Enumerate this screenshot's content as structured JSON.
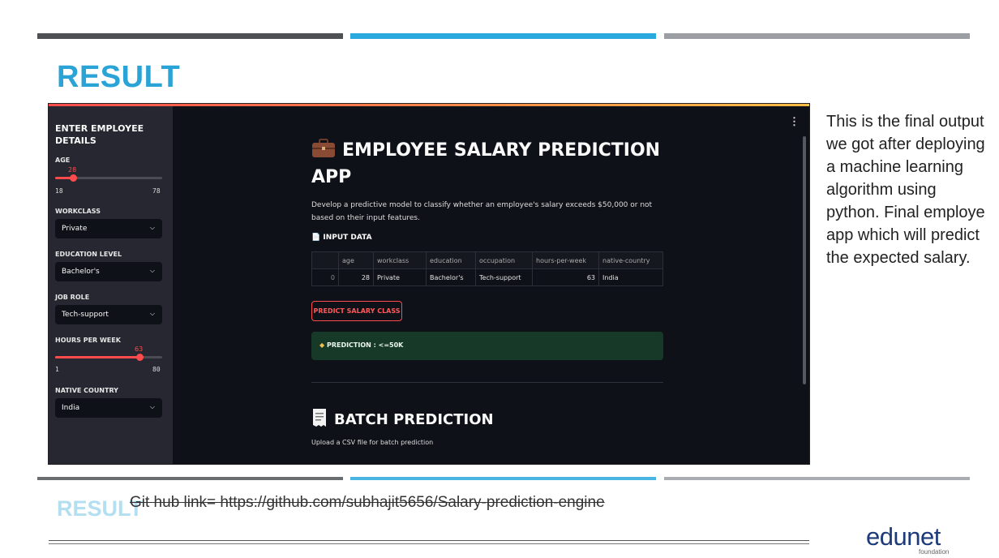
{
  "slide": {
    "title": "RESULT",
    "accent_colors": {
      "bar_dark": "#4d5153",
      "bar_blue": "#29a9de",
      "bar_gray": "#9b9fa4"
    },
    "side_text": "This is the final output we got after deploying a machine learning algorithm using python. Final employe app which will predict the expected salary.",
    "git_link": "Git hub link= https://github.com/subhajit5656/Salary-prediction-engine",
    "logo": {
      "name": "edunet",
      "sub": "foundation"
    }
  },
  "app": {
    "sidebar": {
      "heading": "ENTER EMPLOYEE DETAILS",
      "age": {
        "label": "AGE",
        "value": 28,
        "min": 18,
        "max": 78
      },
      "workclass": {
        "label": "WORKCLASS",
        "value": "Private"
      },
      "education": {
        "label": "EDUCATION LEVEL",
        "value": "Bachelor's"
      },
      "job_role": {
        "label": "JOB ROLE",
        "value": "Tech-support"
      },
      "hours": {
        "label": "HOURS PER WEEK",
        "value": 63,
        "min": 1,
        "max": 80
      },
      "country": {
        "label": "NATIVE COUNTRY",
        "value": "India"
      }
    },
    "main": {
      "title_icon": "briefcase-icon",
      "title": "EMPLOYEE SALARY PREDICTION APP",
      "description": "Develop a predictive model to classify whether an employee's salary exceeds $50,000 or not based on their input features.",
      "input_heading": "INPUT DATA",
      "table": {
        "columns": [
          "",
          "age",
          "workclass",
          "education",
          "occupation",
          "hours-per-week",
          "native-country"
        ],
        "row": [
          "0",
          "28",
          "Private",
          "Bachelor's",
          "Tech-support",
          "63",
          "India"
        ]
      },
      "predict_button": "PREDICT SALARY CLASS",
      "prediction": "PREDICTION : <=50K",
      "batch_heading": "BATCH PREDICTION",
      "batch_sub": "Upload a CSV file for batch prediction"
    }
  }
}
